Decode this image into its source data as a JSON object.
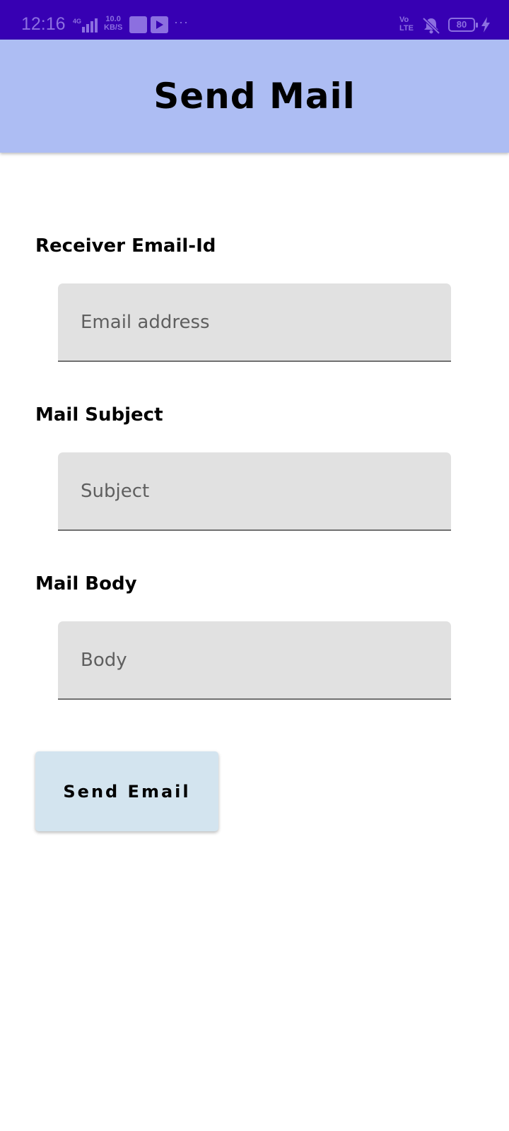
{
  "status_bar": {
    "time": "12:16",
    "network": "4G",
    "speed_value": "10.0",
    "speed_unit": "KB/S",
    "more": "···",
    "volte_top": "Vo",
    "volte_bottom": "LTE",
    "battery": "80",
    "icons": [
      "signal-icon",
      "qr-app-icon",
      "youtube-icon",
      "mute-icon",
      "battery-icon",
      "charging-icon"
    ]
  },
  "app_bar": {
    "title": "Send Mail"
  },
  "form": {
    "receiver_label": "Receiver Email-Id",
    "receiver_placeholder": "Email address",
    "receiver_value": "",
    "subject_label": "Mail Subject",
    "subject_placeholder": "Subject",
    "subject_value": "",
    "body_label": "Mail Body",
    "body_placeholder": "Body",
    "body_value": "",
    "send_label": "Send Email"
  },
  "colors": {
    "status_bar": "#3700b3",
    "app_bar": "#adbdf3",
    "field_bg": "#e1e1e1",
    "button_bg": "#d3e4ef"
  }
}
